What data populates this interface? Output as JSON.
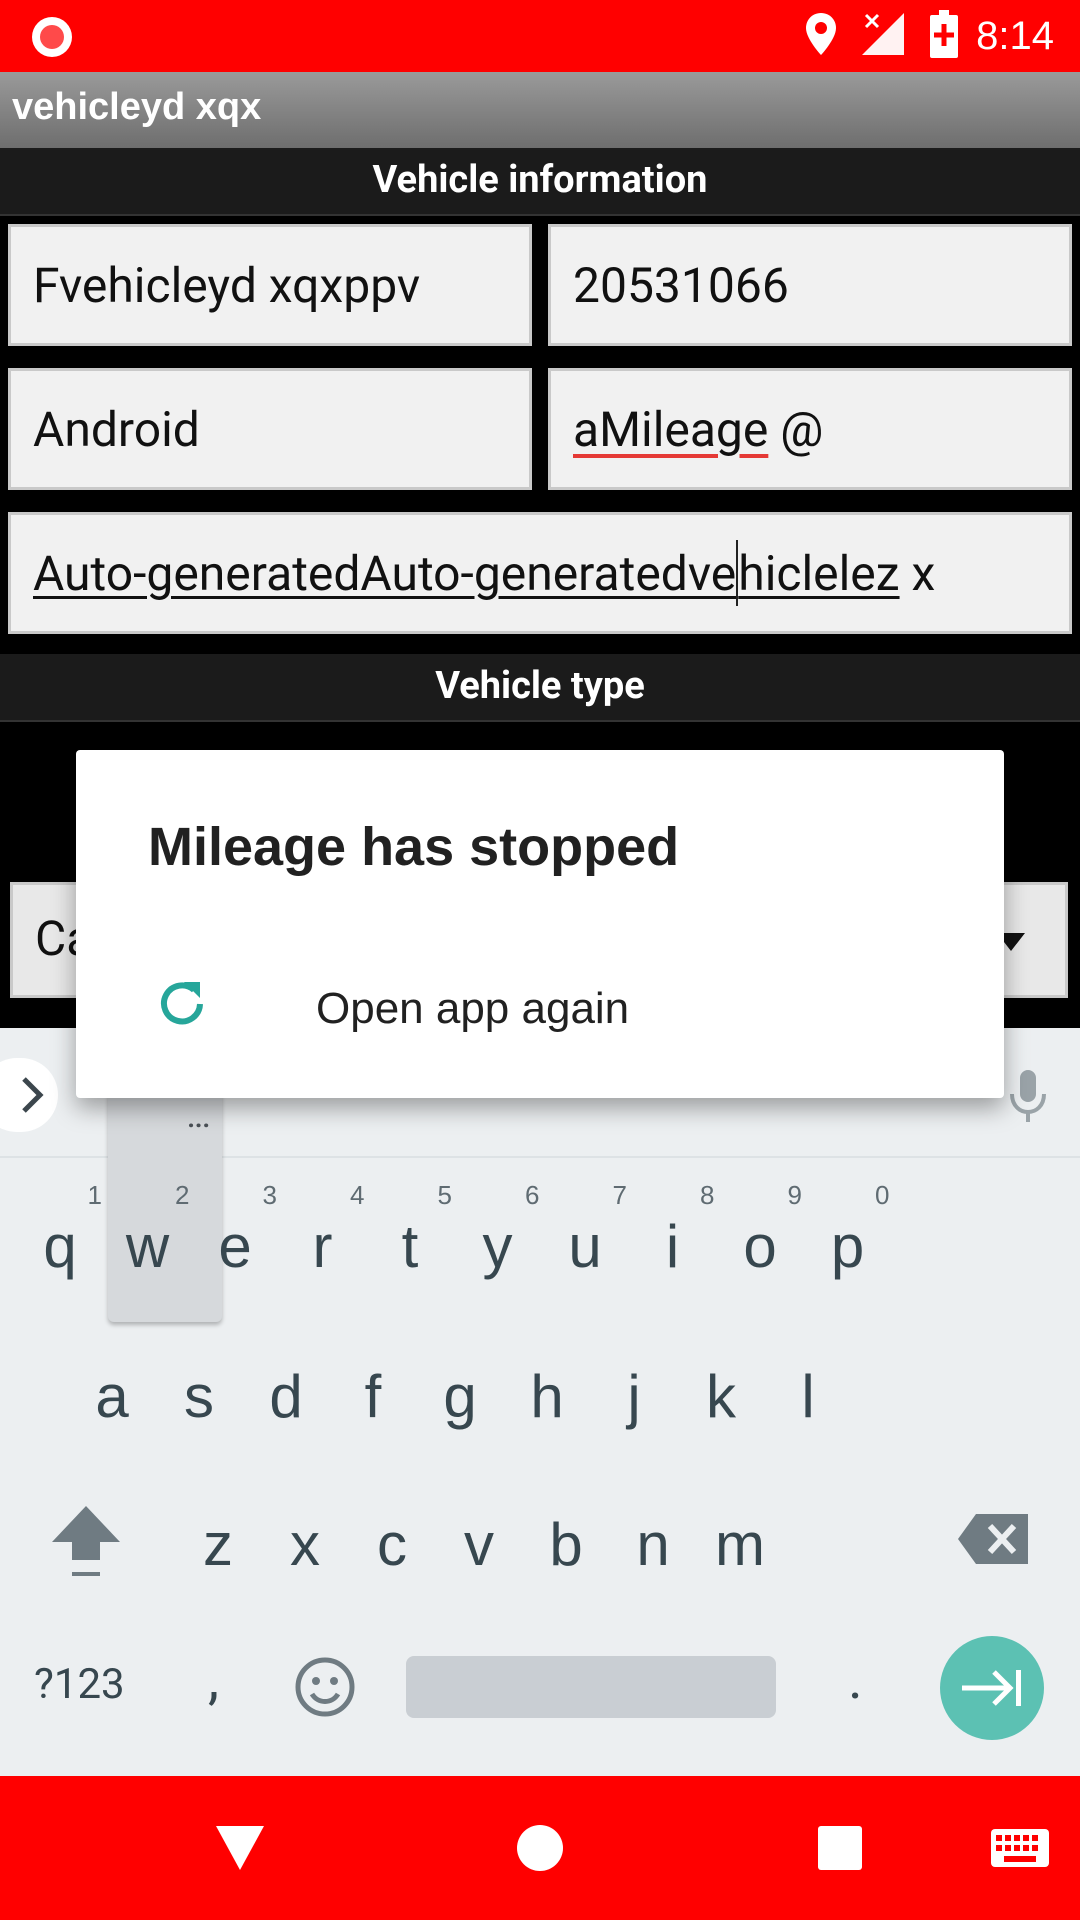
{
  "status_bar": {
    "time": "8:14",
    "icons": [
      "record-icon",
      "location-icon",
      "signal-icon",
      "battery-icon"
    ]
  },
  "app_bar": {
    "title": "vehicleyd xqx"
  },
  "form": {
    "vehicle_information_header": "Vehicle information",
    "name_field": "Fvehicleyd xqxppv",
    "number_field": "20531066",
    "make_field": "Android",
    "model_field_prefix": "aMileage",
    "model_field_suffix": " @",
    "description_field_a": "Auto-generatedAuto-generatedve",
    "description_field_b": "hiclelez",
    "description_field_suffix": " x",
    "vehicle_type_header": "Vehicle type",
    "vehicle_type_value": "Ca"
  },
  "dialog": {
    "title": "Mileage has stopped",
    "action_label": "Open app again",
    "action_icon": "refresh-icon",
    "accent_color": "#26a69a"
  },
  "keyboard": {
    "row1": [
      {
        "ch": "q",
        "hint": "1"
      },
      {
        "ch": "w",
        "hint": "2"
      },
      {
        "ch": "e",
        "hint": "3"
      },
      {
        "ch": "r",
        "hint": "4"
      },
      {
        "ch": "t",
        "hint": "5"
      },
      {
        "ch": "y",
        "hint": "6"
      },
      {
        "ch": "u",
        "hint": "7"
      },
      {
        "ch": "i",
        "hint": "8"
      },
      {
        "ch": "o",
        "hint": "9"
      },
      {
        "ch": "p",
        "hint": "0"
      }
    ],
    "row2": [
      "a",
      "s",
      "d",
      "f",
      "g",
      "h",
      "j",
      "k",
      "l"
    ],
    "row3": [
      "z",
      "x",
      "c",
      "v",
      "b",
      "n",
      "m"
    ],
    "symbols_label": "?123",
    "comma": ",",
    "period": ".",
    "popup_more": "..."
  },
  "colors": {
    "status_bar": "#ff0000",
    "nav_bar": "#ff0000",
    "enter_key": "#5cc1b3"
  }
}
